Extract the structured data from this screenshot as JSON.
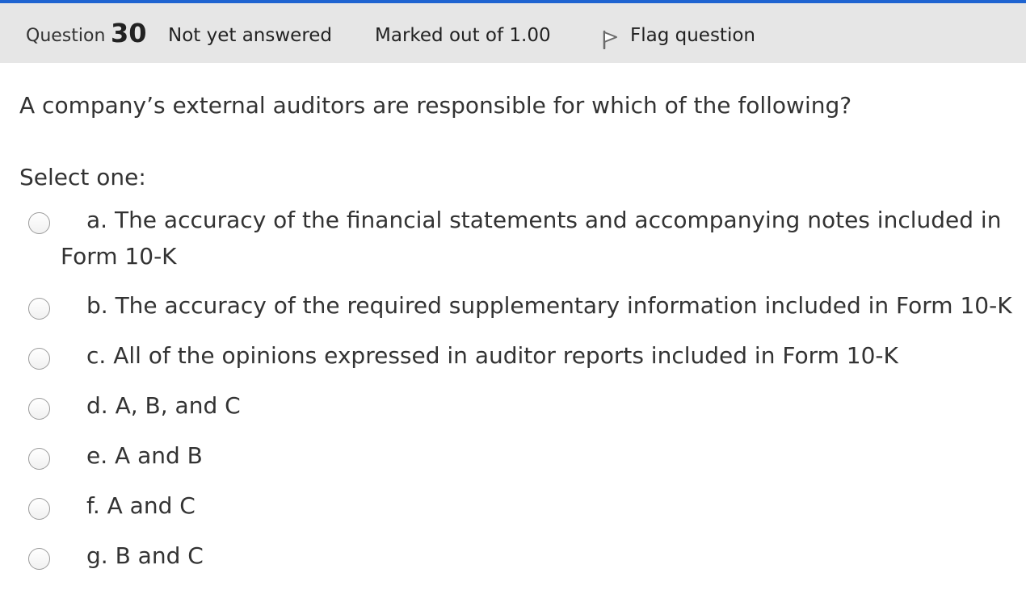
{
  "colors": {
    "accent": "#1f64d1",
    "info_bar_bg": "#e6e6e6",
    "text": "#333333"
  },
  "info": {
    "question_prefix": "Question",
    "question_number": "30",
    "state": "Not yet answered",
    "grade": "Marked out of 1.00",
    "flag_icon": "flag-outline-icon",
    "flag_label": "Flag question"
  },
  "question": {
    "text": "A company’s external auditors are responsible for which of the following?",
    "prompt": "Select one:"
  },
  "answers": [
    {
      "line1": "a. The accuracy of the financial statements and accompanying notes included in",
      "line2": "Form 10-K",
      "selected": false
    },
    {
      "line1": "b. The accuracy of the required supplementary information included in Form 10-K",
      "selected": false
    },
    {
      "line1": "c. All of the opinions expressed in auditor reports included in Form 10-K",
      "selected": false
    },
    {
      "line1": "d. A, B, and C",
      "selected": false
    },
    {
      "line1": "e. A and B",
      "selected": false
    },
    {
      "line1": "f. A and C",
      "selected": false
    },
    {
      "line1": "g. B and C",
      "selected": false
    }
  ]
}
